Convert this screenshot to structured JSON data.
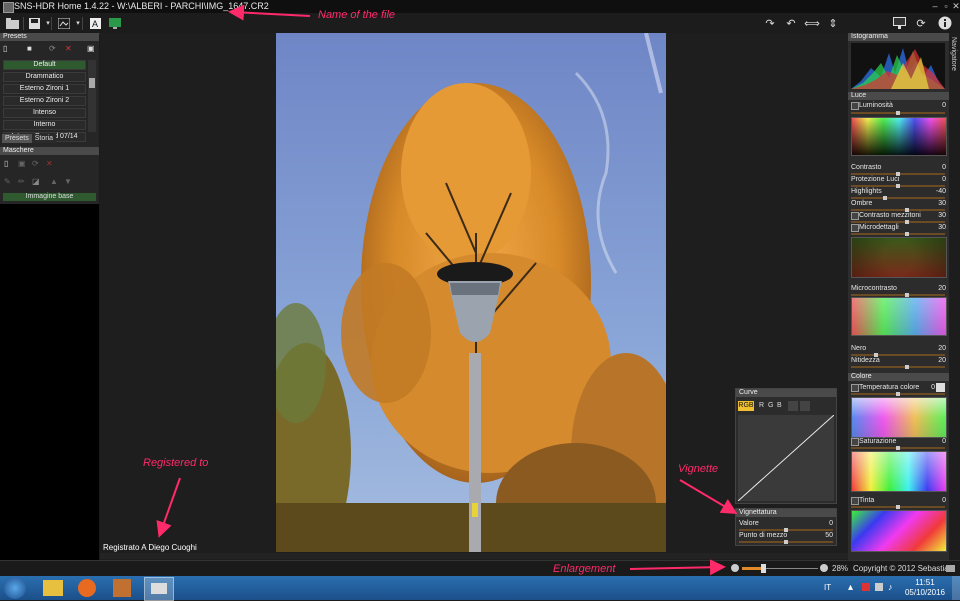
{
  "window": {
    "title": "SNS-HDR Home 1.4.22 - W:\\ALBERI - PARCHI\\IMG_1647.CR2"
  },
  "toolbar": {
    "left_icons": [
      "open-folder-icon",
      "save-icon",
      "export-icon",
      "text-icon",
      "green-screen-icon"
    ],
    "right_icons": [
      "rotate-cw-icon",
      "rotate-ccw-icon",
      "flip-horizontal-icon",
      "flip-vertical-icon",
      "monitor-icon",
      "refresh-icon",
      "info-icon"
    ]
  },
  "presets_panel": {
    "header": "Presets",
    "items": [
      "Default",
      "Drammatico",
      "Esterno Zironi 1",
      "Esterno Zironi 2",
      "Intenso",
      "Interno",
      "Interno Danord 07/14"
    ],
    "selected": "Default",
    "tabs": [
      "Presets",
      "Storia"
    ]
  },
  "masks_panel": {
    "header": "Maschere",
    "items": [
      "Immagine base"
    ]
  },
  "canvas": {
    "registered_text": "Registrato A Diego Cuoghi"
  },
  "curve_panel": {
    "header": "Curve",
    "channels": [
      "RGB",
      "R",
      "G",
      "B"
    ],
    "active_channel": "RGB"
  },
  "vignette_panel": {
    "header": "Vignettatura",
    "sliders": [
      {
        "label": "Valore",
        "value": "0",
        "level": 0.5
      },
      {
        "label": "Punto di mezzo",
        "value": "50",
        "level": 0.5
      }
    ]
  },
  "right_panel": {
    "histogram_header": "Istogramma",
    "luce_header": "Luce",
    "colore_header": "Colore",
    "luce_sliders": [
      {
        "label": "Luminosità",
        "value": "0",
        "level": 0.5
      },
      {
        "label": "Contrasto",
        "value": "0",
        "level": 0.5
      },
      {
        "label": "Protezione Luci",
        "value": "0",
        "level": 0.5
      },
      {
        "label": "Highlights",
        "value": "-40",
        "level": 0.35
      },
      {
        "label": "Ombre",
        "value": "30",
        "level": 0.6
      },
      {
        "label": "Contrasto mezzitoni",
        "value": "30",
        "level": 0.6
      },
      {
        "label": "Microdettagli",
        "value": "30",
        "level": 0.6
      },
      {
        "label": "Microcontrasto",
        "value": "20",
        "level": 0.6
      },
      {
        "label": "Nero",
        "value": "20",
        "level": 0.25
      },
      {
        "label": "Nitidezza",
        "value": "20",
        "level": 0.6
      }
    ],
    "colore_sliders": [
      {
        "label": "Temperatura colore",
        "value": "0",
        "level": 0.5
      },
      {
        "label": "Saturazione",
        "value": "0",
        "level": 0.5
      },
      {
        "label": "Tinta",
        "value": "0",
        "level": 0.5
      }
    ],
    "navigator_label": "Navigatore"
  },
  "status": {
    "zoom": "28%",
    "zoom_level": 0.28,
    "copyright": "Copyright © 2012 Sebastia"
  },
  "annotations": {
    "file_name": "Name of the file",
    "registered": "Registered to",
    "vignette": "Vignette",
    "enlargement": "Enlargement",
    "color": "#ff2a6a"
  },
  "taskbar": {
    "lang": "IT",
    "time": "11:51",
    "date": "05/10/2016"
  }
}
